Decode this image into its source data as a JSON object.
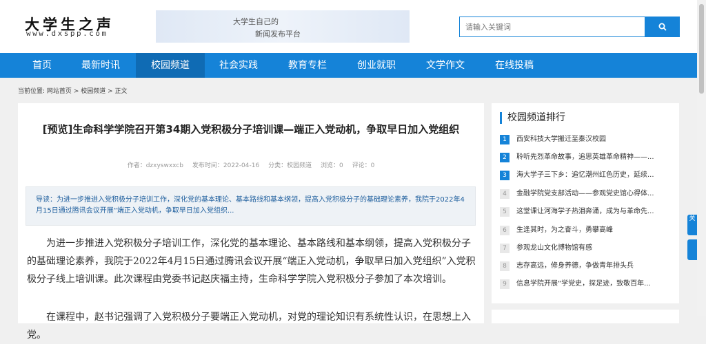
{
  "header": {
    "logo_cn": "大学生之声",
    "logo_url": "www.dxspp.com",
    "banner_line1": "大学生自己的",
    "banner_line2": "新闻发布平台",
    "search_placeholder": "请输入关键词"
  },
  "nav": {
    "items": [
      {
        "label": "首页"
      },
      {
        "label": "最新时讯"
      },
      {
        "label": "校园频道"
      },
      {
        "label": "社会实践"
      },
      {
        "label": "教育专栏"
      },
      {
        "label": "创业就职"
      },
      {
        "label": "文学作文"
      },
      {
        "label": "在线投稿"
      }
    ],
    "active": "校园频道"
  },
  "breadcrumb": {
    "prefix": "当前位置:",
    "home": "网站首页",
    "sep1": ">",
    "channel": "校园频道",
    "sep2": ">",
    "current": "正文"
  },
  "article": {
    "title": "[预览]生命科学学院召开第34期入党积极分子培训课—端正入党动机，争取早日加入党组织",
    "meta": {
      "author": "作者：dzxyswxxcb",
      "date": "发布时间：2022-04-16",
      "category": "分类：校园频道",
      "views": "浏览：0",
      "comments": "评论：0"
    },
    "lead": "导读：为进一步推进入党积极分子培训工作，深化党的基本理论、基本路线和基本纲领，提高入党积极分子的基础理论素养，我院于2022年4月15日通过腾讯会议开展“端正入党动机，争取早日加入党组织...",
    "para1": "为进一步推进入党积极分子培训工作，深化党的基本理论、基本路线和基本纲领，提高入党积极分子的基础理论素养，我院于2022年4月15日通过腾讯会议开展“端正入党动机，争取早日加入党组织”入党积极分子线上培训课。此次课程由党委书记赵庆福主持，生命科学学院入党积极分子参加了本次培训。",
    "para2": "在课程中，赵书记强调了入党积极分子要端正入党动机，对党的理论知识有系统性认识，在思想上入党。"
  },
  "sidebar": {
    "title": "校园频道排行",
    "items": [
      {
        "num": "1",
        "text": "西安科技大学搬迁至秦汉校园"
      },
      {
        "num": "2",
        "text": "聆听先烈革命故事，追思英雄革命精神——..."
      },
      {
        "num": "3",
        "text": "海大学子三下乡：追忆潮州红色历史，延续..."
      },
      {
        "num": "4",
        "text": "金融学院党支部活动——参观党史馆心得体..."
      },
      {
        "num": "5",
        "text": "这堂课让河海学子热泪奔涌，成为与革命先..."
      },
      {
        "num": "6",
        "text": "生逢其时，为之奋斗，勇攀高峰"
      },
      {
        "num": "7",
        "text": "参观龙山文化博物馆有感"
      },
      {
        "num": "8",
        "text": "志存高远，修身养德，争做青年排头兵"
      },
      {
        "num": "9",
        "text": "信息学院开展“学党史，探足迹，致敬百年..."
      }
    ]
  },
  "float": {
    "tab1": "关",
    "tab2": ""
  },
  "colors": {
    "brand_blue": "#1583d8",
    "nav_active": "#0f6bb4"
  }
}
